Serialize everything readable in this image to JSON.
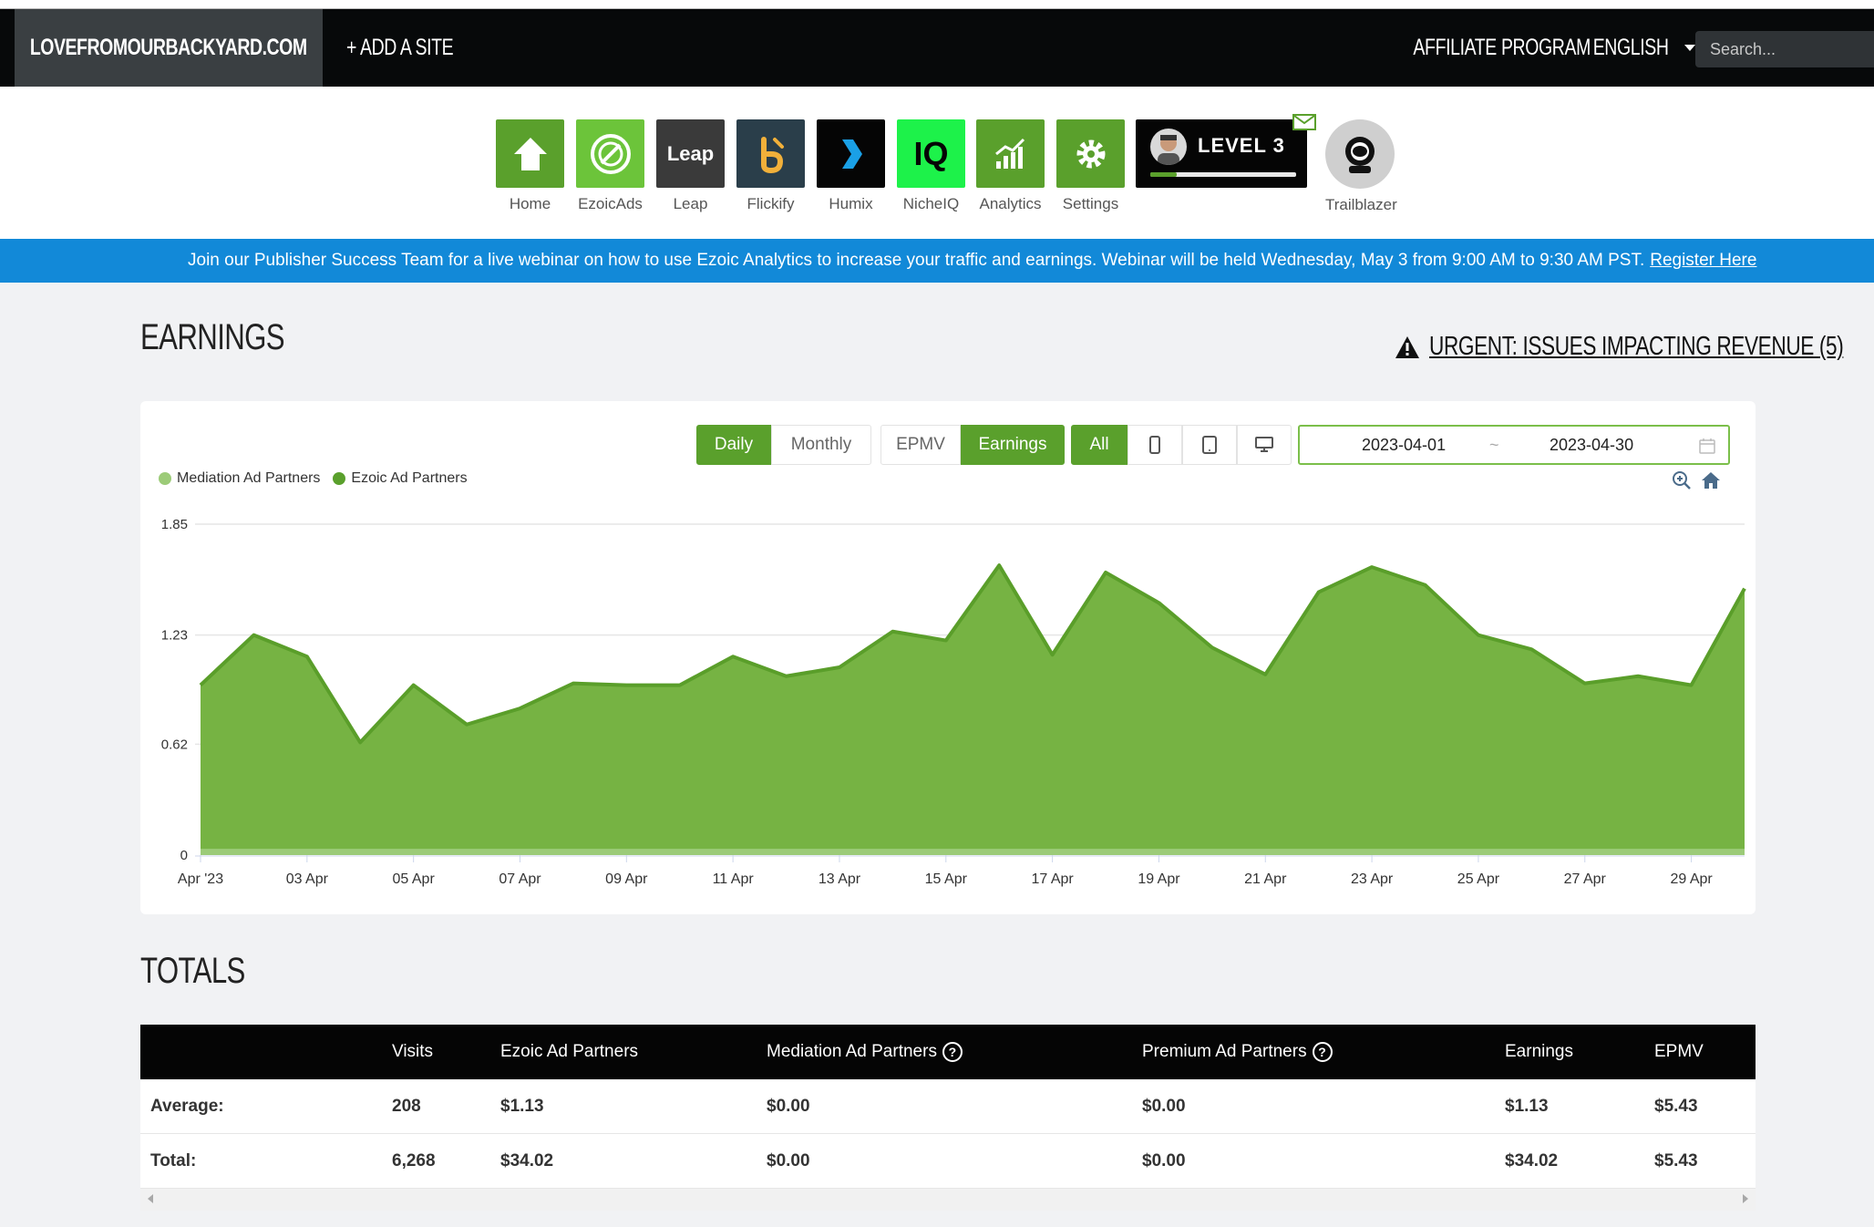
{
  "navbar": {
    "site_name": "LOVEFROMOURBACKYARD.COM",
    "add_site": "+ ADD A SITE",
    "affiliate": "AFFILIATE PROGRAM",
    "language": "ENGLISH",
    "search_placeholder": "Search..."
  },
  "apps": [
    {
      "label": "Home",
      "color": "#5aa02c"
    },
    {
      "label": "EzoicAds",
      "color": "#6cc43a"
    },
    {
      "label": "Leap",
      "color": "#3a3a3a"
    },
    {
      "label": "Flickify",
      "color": "#2a3e4a"
    },
    {
      "label": "Humix",
      "color": "#050505"
    },
    {
      "label": "NicheIQ",
      "color": "#1df24a"
    },
    {
      "label": "Analytics",
      "color": "#5aa02c"
    },
    {
      "label": "Settings",
      "color": "#5aa02c"
    }
  ],
  "app_tile_text": {
    "leap": "Leap",
    "nicheiq": "IQ"
  },
  "level": {
    "label": "LEVEL 3",
    "progress": 0.18
  },
  "trailblazer_label": "Trailblazer",
  "banner": {
    "text": "Join our Publisher Success Team for a live webinar on how to use Ezoic Analytics to increase your traffic and earnings. Webinar will be held Wednesday, May 3 from 9:00 AM to 9:30 AM PST.",
    "link": "Register Here"
  },
  "earnings_title": "EARNINGS",
  "urgent_text": "URGENT: ISSUES IMPACTING REVENUE (5)",
  "controls": {
    "period": [
      "Daily",
      "Monthly"
    ],
    "metric": [
      "EPMV",
      "Earnings"
    ],
    "device_all": "All",
    "date_start": "2023-04-01",
    "date_sep": "~",
    "date_end": "2023-04-30"
  },
  "colors": {
    "brand_green": "#5aa02c",
    "area_fill": "#76b343",
    "area_line": "#5a9e2a",
    "mediation_dot": "#9ccb78",
    "banner_blue": "#1289d8"
  },
  "chart_data": {
    "type": "area",
    "series": [
      {
        "name": "Mediation Ad Partners",
        "values": [
          0.02,
          0.02,
          0.02,
          0.02,
          0.02,
          0.02,
          0.02,
          0.02,
          0.02,
          0.02,
          0.02,
          0.02,
          0.02,
          0.02,
          0.02,
          0.02,
          0.02,
          0.02,
          0.02,
          0.02,
          0.02,
          0.02,
          0.02,
          0.02,
          0.02,
          0.02,
          0.02,
          0.02,
          0.02,
          0.02
        ]
      },
      {
        "name": "Ezoic Ad Partners",
        "values": [
          0.95,
          1.23,
          1.11,
          0.63,
          0.95,
          0.73,
          0.82,
          0.96,
          0.95,
          0.95,
          1.11,
          1.0,
          1.05,
          1.25,
          1.2,
          1.62,
          1.12,
          1.58,
          1.41,
          1.16,
          1.01,
          1.47,
          1.61,
          1.51,
          1.23,
          1.15,
          0.96,
          1.0,
          0.95,
          1.49
        ]
      }
    ],
    "x": [
      "2023-04-01",
      "2023-04-02",
      "2023-04-03",
      "2023-04-04",
      "2023-04-05",
      "2023-04-06",
      "2023-04-07",
      "2023-04-08",
      "2023-04-09",
      "2023-04-10",
      "2023-04-11",
      "2023-04-12",
      "2023-04-13",
      "2023-04-14",
      "2023-04-15",
      "2023-04-16",
      "2023-04-17",
      "2023-04-18",
      "2023-04-19",
      "2023-04-20",
      "2023-04-21",
      "2023-04-22",
      "2023-04-23",
      "2023-04-24",
      "2023-04-25",
      "2023-04-26",
      "2023-04-27",
      "2023-04-28",
      "2023-04-29",
      "2023-04-30"
    ],
    "x_tick_labels": [
      "Apr '23",
      "03 Apr",
      "05 Apr",
      "07 Apr",
      "09 Apr",
      "11 Apr",
      "13 Apr",
      "15 Apr",
      "17 Apr",
      "19 Apr",
      "21 Apr",
      "23 Apr",
      "25 Apr",
      "27 Apr",
      "29 Apr"
    ],
    "y_ticks": [
      "0",
      "0.62",
      "1.23",
      "1.85"
    ],
    "ylim": [
      0,
      1.85
    ],
    "grid": true,
    "legend": "top-left",
    "title": "",
    "xlabel": "",
    "ylabel": ""
  },
  "totals": {
    "title": "TOTALS",
    "headers": [
      "",
      "Visits",
      "Ezoic Ad Partners",
      "Mediation Ad Partners",
      "Premium Ad Partners",
      "Earnings",
      "EPMV"
    ],
    "rows": [
      [
        "Average:",
        "208",
        "$1.13",
        "$0.00",
        "$0.00",
        "$1.13",
        "$5.43"
      ],
      [
        "Total:",
        "6,268",
        "$34.02",
        "$0.00",
        "$0.00",
        "$34.02",
        "$5.43"
      ]
    ]
  }
}
